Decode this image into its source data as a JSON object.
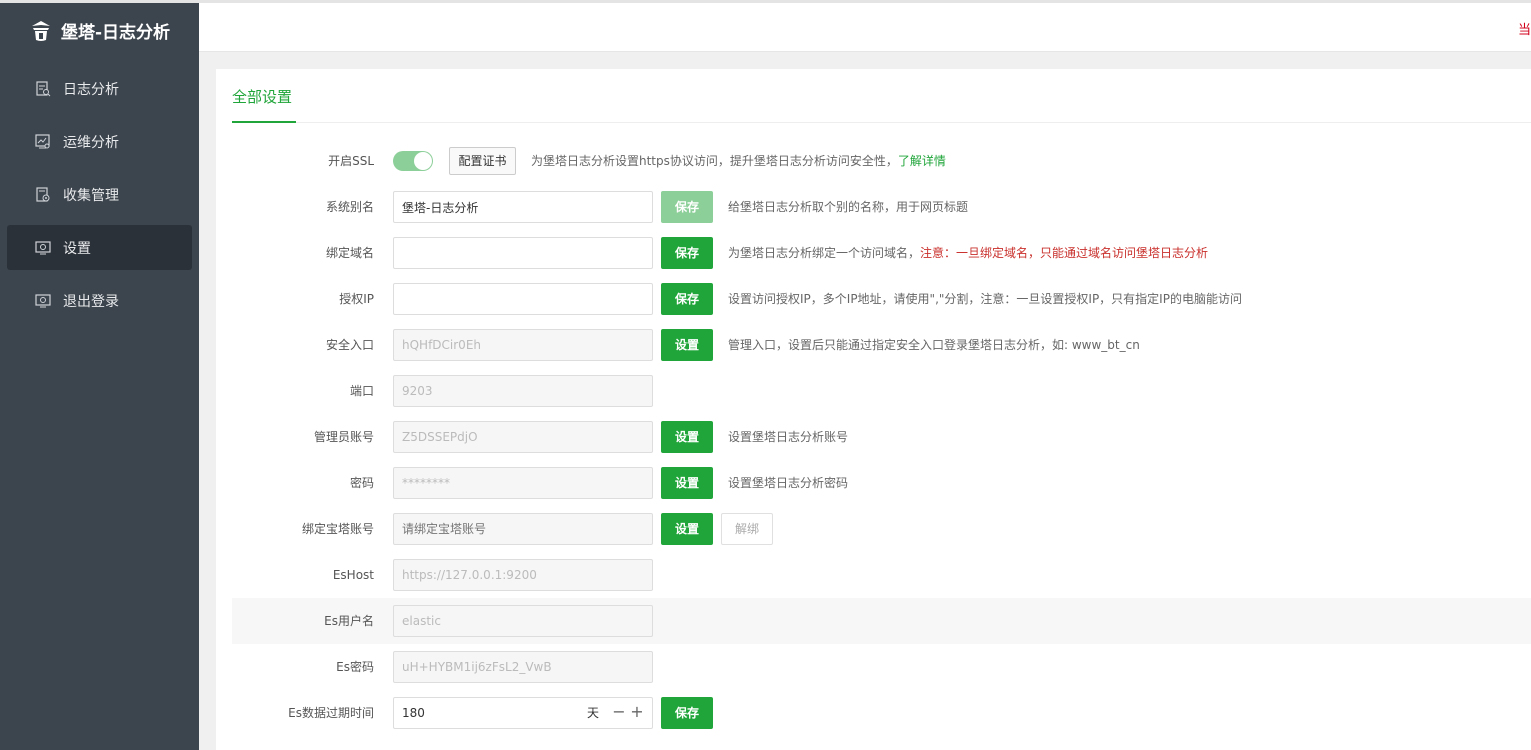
{
  "app": {
    "title": "堡塔-日志分析"
  },
  "sidebar": {
    "items": [
      {
        "label": "日志分析",
        "icon": "log-file-icon",
        "active": false
      },
      {
        "label": "运维分析",
        "icon": "monitor-chart-icon",
        "active": false
      },
      {
        "label": "收集管理",
        "icon": "gear-doc-icon",
        "active": false
      },
      {
        "label": "设置",
        "icon": "settings-screen-icon",
        "active": true
      },
      {
        "label": "退出登录",
        "icon": "logout-screen-icon",
        "active": false
      }
    ]
  },
  "header": {
    "right_text": "当"
  },
  "tabs": [
    {
      "label": "全部设置"
    }
  ],
  "settings": {
    "ssl": {
      "label": "开启SSL",
      "enabled": true,
      "cert_button": "配置证书",
      "tip": "为堡塔日志分析设置https协议访问，提升堡塔日志分析访问安全性，",
      "tip_link": "了解详情"
    },
    "alias": {
      "label": "系统别名",
      "value": "堡塔-日志分析",
      "button": "保存",
      "tip": "给堡塔日志分析取个别的名称，用于网页标题"
    },
    "domain": {
      "label": "绑定域名",
      "value": "",
      "button": "保存",
      "tip": "为堡塔日志分析绑定一个访问域名，",
      "tip_warn": "注意：一旦绑定域名，只能通过域名访问堡塔日志分析"
    },
    "auth_ip": {
      "label": "授权IP",
      "value": "",
      "button": "保存",
      "tip": "设置访问授权IP，多个IP地址，请使用\",\"分割，注意：一旦设置授权IP，只有指定IP的电脑能访问"
    },
    "entry": {
      "label": "安全入口",
      "value": "hQHfDCir0Eh",
      "button": "设置",
      "tip": "管理入口，设置后只能通过指定安全入口登录堡塔日志分析，如: www_bt_cn"
    },
    "port": {
      "label": "端口",
      "value": "9203"
    },
    "admin": {
      "label": "管理员账号",
      "value": "Z5DSSEPdjO",
      "button": "设置",
      "tip": "设置堡塔日志分析账号"
    },
    "password": {
      "label": "密码",
      "value": "********",
      "button": "设置",
      "tip": "设置堡塔日志分析密码"
    },
    "bt_account": {
      "label": "绑定宝塔账号",
      "placeholder": "请绑定宝塔账号",
      "button": "设置",
      "unbind_button": "解绑"
    },
    "es_host": {
      "label": "EsHost",
      "value": "https://127.0.0.1:9200"
    },
    "es_user": {
      "label": "Es用户名",
      "value": "elastic"
    },
    "es_password": {
      "label": "Es密码",
      "value": "uH+HYBM1ij6zFsL2_VwB"
    },
    "es_expire": {
      "label": "Es数据过期时间",
      "value": "180",
      "unit": "天",
      "minus": "−",
      "plus": "+",
      "button": "保存"
    }
  },
  "colors": {
    "accent": "#20a53a",
    "accent_light": "#8ccf99",
    "sidebar_bg": "#3c444d",
    "warn": "#c9302c"
  }
}
